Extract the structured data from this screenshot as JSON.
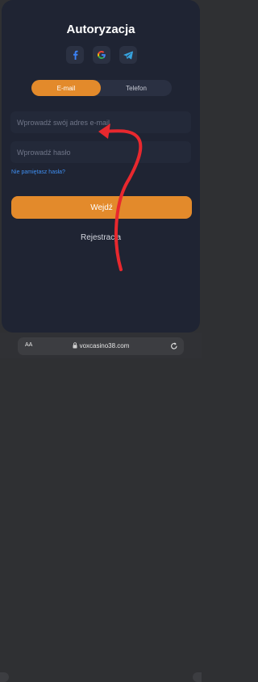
{
  "header": {
    "title": "Autoryzacja"
  },
  "social": [
    {
      "name": "facebook-icon"
    },
    {
      "name": "google-icon"
    },
    {
      "name": "telegram-icon"
    }
  ],
  "tabs": {
    "email": "E-mail",
    "phone": "Telefon",
    "active": "E-mail"
  },
  "form": {
    "email_placeholder": "Wprowadź swój adres e-mail",
    "password_placeholder": "Wprowadź hasło",
    "forgot_label": "Nie pamiętasz hasła?",
    "submit_label": "Wejdź",
    "register_label": "Rejestracja"
  },
  "browser": {
    "text_size_label": "AA",
    "url": "voxcasino38.com"
  },
  "colors": {
    "accent": "#e38a2b",
    "link": "#3f8ef0",
    "background": "#1f2433",
    "annotation_arrow": "#e8282e"
  }
}
